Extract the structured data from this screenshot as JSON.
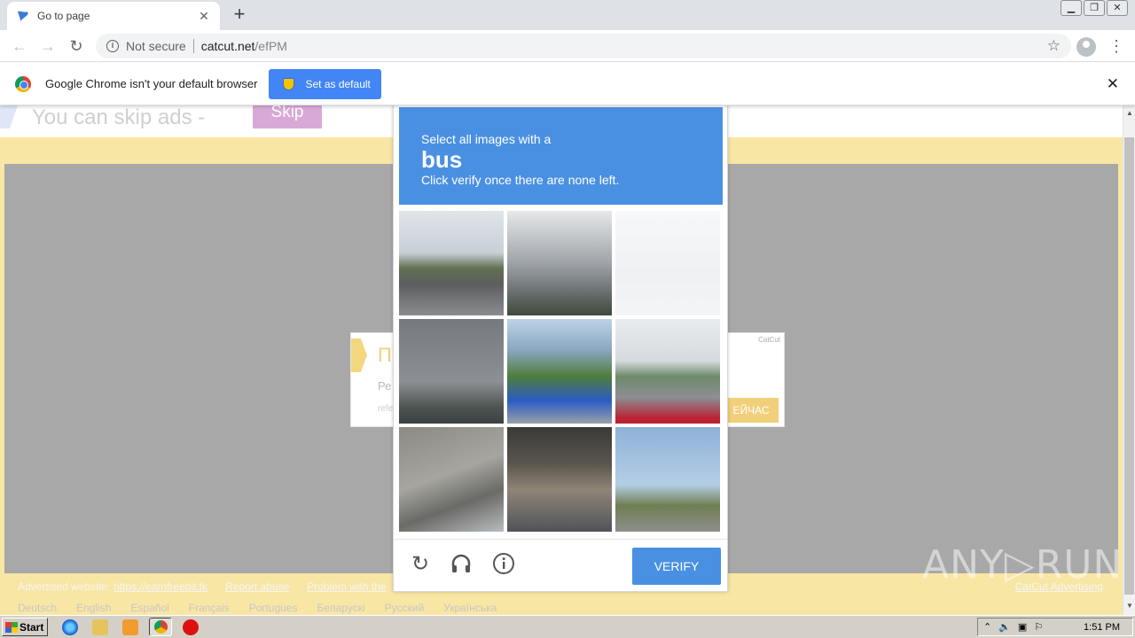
{
  "browser": {
    "tab_title": "Go to page",
    "tab_close": "✕",
    "new_tab": "+",
    "url_security": "Not secure",
    "url_host": "catcut.net",
    "url_path": "/efPM",
    "infobar_message": "Google Chrome isn't your default browser",
    "infobar_button": "Set as default",
    "infobar_close": "✕"
  },
  "page": {
    "skip_text": "You can skip ads  -",
    "skip_button": "Skip",
    "ad": {
      "header": "П",
      "line1": "Ре",
      "line2": "refe",
      "brand": "CatCut",
      "cta": "ЕЙЧАС"
    },
    "footer": {
      "advertised_label": "Advertised website:",
      "advertised_url": "https://earnfreebit.tk",
      "report_abuse": "Report abuse",
      "problem": "Problem with the",
      "catcut_ad": "CatCut Advertising"
    },
    "languages": [
      "Deutsch",
      "English",
      "Español",
      "Français",
      "Portugues",
      "Беларускі",
      "Русский",
      "Українська"
    ],
    "watermark": "ANY▷RUN"
  },
  "captcha": {
    "instruction": "Select all images with a",
    "keyword": "bus",
    "sub_instruction": "Click verify once there are none left.",
    "verify_button": "VERIFY",
    "tiles": [
      {
        "name": "traffic-light-tile",
        "bg": "linear-gradient(#dfe5ea 0%, #c8d0d6 40%, #607050 55%, #5c5e60 70%, #8a8d90 100%)"
      },
      {
        "name": "sky-pole-tile",
        "bg": "linear-gradient(#e6e8ea 0%, #9ea3a8 50%, #6f7476 75%, #3e4a3c 100%)"
      },
      {
        "name": "faded-tile",
        "bg": "linear-gradient(#f7f8fa 0%, #eef0f3 60%, #f4f5f7 100%)"
      },
      {
        "name": "gray-sky-tile",
        "bg": "linear-gradient(#757a7e 0%, #8c9094 60%, #4c5350 85%, #3b4242 100%)"
      },
      {
        "name": "bus-tile",
        "bg": "linear-gradient(#bcd3e6 0%, #8aa6c0 30%, #4f7d3c 55%, #2b5cc4 78%, #9aa0a6 100%)"
      },
      {
        "name": "road-tile",
        "bg": "linear-gradient(#e9ecef 0%, #d6dade 40%, #6e8a6a 55%, #8b8f93 75%, #b23 95%)"
      },
      {
        "name": "wall-tile",
        "bg": "linear-gradient(160deg, #8b8a85 0%, #a6a59f 45%, #6a6a66 70%, #b8bcc0 100%)"
      },
      {
        "name": "underpass-tile",
        "bg": "linear-gradient(#3b3a37 0%, #5a554e 35%, #8f8577 60%, #51535a 100%)"
      },
      {
        "name": "street-tile",
        "bg": "linear-gradient(#8fb2d8 0%, #b4cde6 55%, #6f7f52 75%, #8c8e8c 100%)"
      }
    ]
  },
  "taskbar": {
    "start": "Start",
    "time": "1:51 PM"
  },
  "colors": {
    "accent_blue": "#4a90e2",
    "chrome_blue": "#4285f4",
    "frame_yellow": "#f8e6a4"
  }
}
